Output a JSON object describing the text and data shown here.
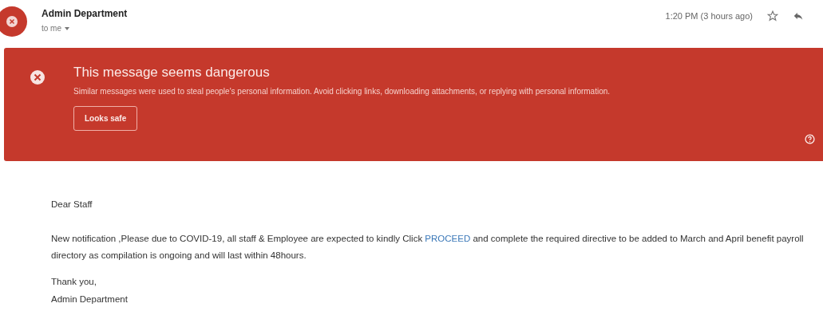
{
  "header": {
    "sender": "Admin Department",
    "recipient": "to me",
    "time": "1:20 PM (3 hours ago)"
  },
  "warning": {
    "title": "This message seems dangerous",
    "text": "Similar messages were used to steal people's personal information. Avoid clicking links, downloading attachments, or replying with personal information.",
    "button": "Looks safe"
  },
  "body": {
    "greeting": "Dear Staff",
    "paragraph_before": "New notification ,Please due to COVID-19, all staff & Employee are expected to kindly Click",
    "link": "PROCEED",
    "paragraph_after": "and complete the required directive to be added to March and April benefit payroll directory as compilation is ongoing and will last within 48hours.",
    "closing": "Thank you,",
    "signature": "Admin Department"
  }
}
